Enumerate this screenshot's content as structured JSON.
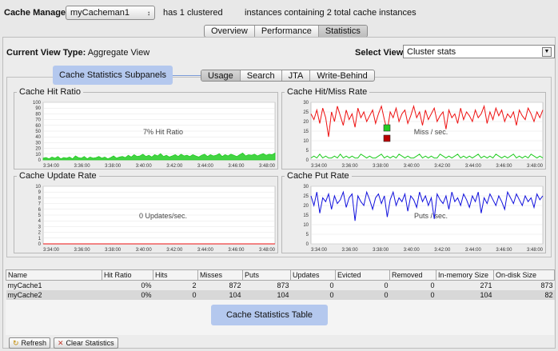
{
  "header": {
    "cache_manager_label": "Cache Manager:",
    "cache_manager_value": "myCacheman1",
    "clustered_text": "has 1 clustered",
    "instances_text": "instances containing 2 total cache instances"
  },
  "top_tabs": [
    {
      "label": "Overview",
      "active": false
    },
    {
      "label": "Performance",
      "active": false
    },
    {
      "label": "Statistics",
      "active": true
    }
  ],
  "view": {
    "current_label": "Current View Type:",
    "current_value": "Aggregate View",
    "select_label": "Select View:",
    "select_value": "Cluster stats"
  },
  "callouts": {
    "subpanels": "Cache Statistics Subpanels",
    "table": "Cache Statistics Table"
  },
  "sub_tabs": [
    {
      "label": "Usage",
      "active": true
    },
    {
      "label": "Search",
      "active": false
    },
    {
      "label": "JTA",
      "active": false
    },
    {
      "label": "Write-Behind",
      "active": false
    }
  ],
  "chart_data": [
    {
      "type": "area",
      "title": "Cache Hit Ratio",
      "annotation": "7% Hit Ratio",
      "x_ticks": [
        "3:34:00",
        "3:36:00",
        "3:38:00",
        "3:40:00",
        "3:42:00",
        "3:44:00",
        "3:46:00",
        "3:48:00"
      ],
      "y_ticks": [
        0,
        10,
        20,
        30,
        40,
        50,
        60,
        70,
        80,
        90,
        100
      ],
      "ylim": [
        0,
        100
      ],
      "series": [
        {
          "color": "#22cc22",
          "values": [
            3,
            4,
            2,
            5,
            3,
            6,
            2,
            4,
            3,
            5,
            2,
            7,
            4,
            3,
            6,
            2,
            5,
            3,
            4,
            6,
            3,
            5,
            2,
            4,
            7,
            3,
            5,
            6,
            4,
            8,
            5,
            9,
            6,
            7,
            10,
            6,
            8,
            5,
            9,
            7,
            11,
            6,
            8,
            5,
            7,
            9,
            6,
            10,
            7,
            8,
            6,
            9,
            7,
            5,
            8,
            10,
            6,
            9,
            7,
            8,
            11,
            6,
            9,
            7,
            10,
            8,
            6,
            9,
            12,
            7,
            9,
            8,
            10,
            7,
            9,
            11,
            8,
            10,
            9,
            12
          ]
        }
      ]
    },
    {
      "type": "line",
      "title": "Cache Hit/Miss Rate",
      "annotation": "Miss / sec.",
      "x_ticks": [
        "3:34:00",
        "3:36:00",
        "3:38:00",
        "3:40:00",
        "3:42:00",
        "3:44:00",
        "3:46:00",
        "3:48:00"
      ],
      "y_ticks": [
        0,
        5,
        10,
        15,
        20,
        25,
        30
      ],
      "ylim": [
        0,
        30
      ],
      "series": [
        {
          "color": "#ee1111",
          "values": [
            24,
            21,
            26,
            19,
            27,
            22,
            12,
            25,
            20,
            28,
            23,
            18,
            26,
            21,
            24,
            17,
            27,
            22,
            25,
            20,
            23,
            26,
            19,
            24,
            28,
            21,
            15,
            25,
            22,
            27,
            20,
            24,
            26,
            19,
            23,
            28,
            22,
            25,
            18,
            26,
            21,
            24,
            27,
            20,
            23,
            25,
            16,
            26,
            22,
            24,
            19,
            27,
            21,
            25,
            23,
            20,
            26,
            22,
            24,
            28,
            19,
            25,
            21,
            27,
            23,
            26,
            20,
            24,
            22,
            25,
            18,
            26,
            23,
            21,
            27,
            24,
            20,
            25,
            22,
            26
          ]
        },
        {
          "color": "#22cc22",
          "values": [
            1,
            2,
            1,
            3,
            1,
            2,
            1,
            1,
            2,
            1,
            3,
            1,
            2,
            1,
            2,
            1,
            1,
            3,
            2,
            1,
            2,
            1,
            1,
            2,
            3,
            1,
            2,
            1,
            2,
            1,
            3,
            2,
            1,
            2,
            1,
            1,
            2,
            3,
            1,
            2,
            1,
            2,
            1,
            1,
            3,
            2,
            1,
            2,
            1,
            2,
            3,
            1,
            2,
            1,
            2,
            1,
            2,
            3,
            1,
            2,
            1,
            2,
            1,
            3,
            2,
            1,
            2,
            1,
            2,
            3,
            1,
            2,
            1,
            2,
            1,
            3,
            2,
            1,
            2,
            1
          ]
        }
      ]
    },
    {
      "type": "line",
      "title": "Cache Update Rate",
      "annotation": "0 Updates/sec.",
      "x_ticks": [
        "3:34:00",
        "3:36:00",
        "3:38:00",
        "3:40:00",
        "3:42:00",
        "3:44:00",
        "3:46:00",
        "3:48:00"
      ],
      "y_ticks": [
        0,
        1,
        2,
        3,
        4,
        5,
        6,
        7,
        8,
        9,
        10
      ],
      "ylim": [
        0,
        10
      ],
      "series": [
        {
          "color": "#ee1111",
          "values": [
            0,
            0,
            0,
            0,
            0,
            0,
            0,
            0,
            0,
            0,
            0,
            0,
            0,
            0,
            0,
            0,
            0,
            0,
            0,
            0,
            0,
            0,
            0,
            0,
            0,
            0,
            0,
            0,
            0,
            0
          ]
        }
      ]
    },
    {
      "type": "line",
      "title": "Cache Put Rate",
      "annotation": "Puts / sec.",
      "x_ticks": [
        "3:34:00",
        "3:36:00",
        "3:38:00",
        "3:40:00",
        "3:42:00",
        "3:44:00",
        "3:46:00",
        "3:48:00"
      ],
      "y_ticks": [
        0,
        5,
        10,
        15,
        20,
        25,
        30
      ],
      "ylim": [
        0,
        30
      ],
      "series": [
        {
          "color": "#1111dd",
          "values": [
            25,
            20,
            27,
            16,
            24,
            22,
            26,
            18,
            25,
            21,
            23,
            27,
            19,
            24,
            26,
            12,
            25,
            22,
            20,
            27,
            23,
            18,
            24,
            26,
            21,
            25,
            14,
            23,
            27,
            20,
            24,
            22,
            26,
            17,
            25,
            23,
            19,
            27,
            22,
            25,
            20,
            24,
            13,
            26,
            23,
            21,
            25,
            18,
            27,
            22,
            24,
            20,
            26,
            23,
            19,
            25,
            22,
            27,
            16,
            24,
            21,
            26,
            23,
            20,
            25,
            22,
            18,
            27,
            24,
            21,
            26,
            23,
            20,
            25,
            22,
            24,
            19,
            26,
            23,
            25
          ]
        }
      ]
    }
  ],
  "table": {
    "columns": [
      "Name",
      "Hit Ratio",
      "Hits",
      "Misses",
      "Puts",
      "Updates",
      "Evicted",
      "Removed",
      "In-memory Size",
      "On-disk Size"
    ],
    "rows": [
      [
        "myCache1",
        "0%",
        "2",
        "872",
        "873",
        "0",
        "0",
        "0",
        "271",
        "873"
      ],
      [
        "myCache2",
        "0%",
        "0",
        "104",
        "104",
        "0",
        "0",
        "0",
        "104",
        "82"
      ]
    ]
  },
  "bottom_buttons": {
    "refresh": "Refresh",
    "clear": "Clear Statistics"
  }
}
